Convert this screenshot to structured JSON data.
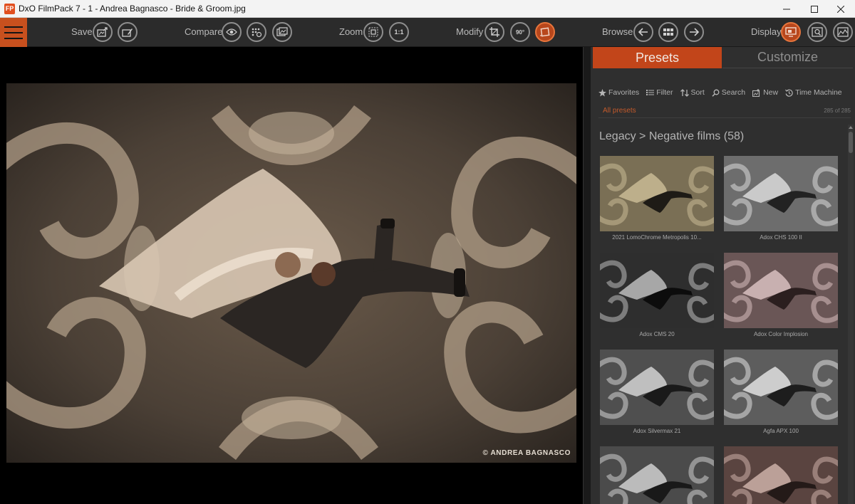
{
  "window": {
    "app_icon_text": "FP",
    "title": "DxO FilmPack 7 - 1 - Andrea Bagnasco - Bride & Groom.jpg"
  },
  "toolbar": {
    "save_label": "Save",
    "compare_label": "Compare",
    "zoom_label": "Zoom",
    "zoom_one_to_one": "1:1",
    "modify_label": "Modify",
    "rotate_label": "90°",
    "browse_label": "Browse",
    "display_label": "Display"
  },
  "viewer": {
    "copyright": "© ANDREA BAGNASCO"
  },
  "panel": {
    "tabs": [
      {
        "label": "Presets",
        "active": true
      },
      {
        "label": "Customize",
        "active": false
      }
    ],
    "tools": [
      {
        "label": "Favorites",
        "icon": "star-icon"
      },
      {
        "label": "Filter",
        "icon": "list-icon"
      },
      {
        "label": "Sort",
        "icon": "sort-icon"
      },
      {
        "label": "Search",
        "icon": "magnifier-icon"
      },
      {
        "label": "New",
        "icon": "new-preset-icon"
      },
      {
        "label": "Time Machine",
        "icon": "history-icon"
      }
    ],
    "filter": {
      "label": "All presets",
      "count": "285 of 285"
    },
    "section_title": "Legacy > Negative films (58)",
    "presets": [
      {
        "name": "2021 LomoChrome Metropolis 10..."
      },
      {
        "name": "Adox CHS 100 II"
      },
      {
        "name": "Adox CMS 20"
      },
      {
        "name": "Adox Color Implosion"
      },
      {
        "name": "Adox Silvermax 21"
      },
      {
        "name": "Agfa APX 100"
      },
      {
        "name": ""
      },
      {
        "name": ""
      }
    ]
  },
  "colors": {
    "accent": "#c2451a",
    "accent_button": "#b8471c",
    "toolbar_bg": "#2b2b2b",
    "panel_bg": "#2f2f2f"
  }
}
